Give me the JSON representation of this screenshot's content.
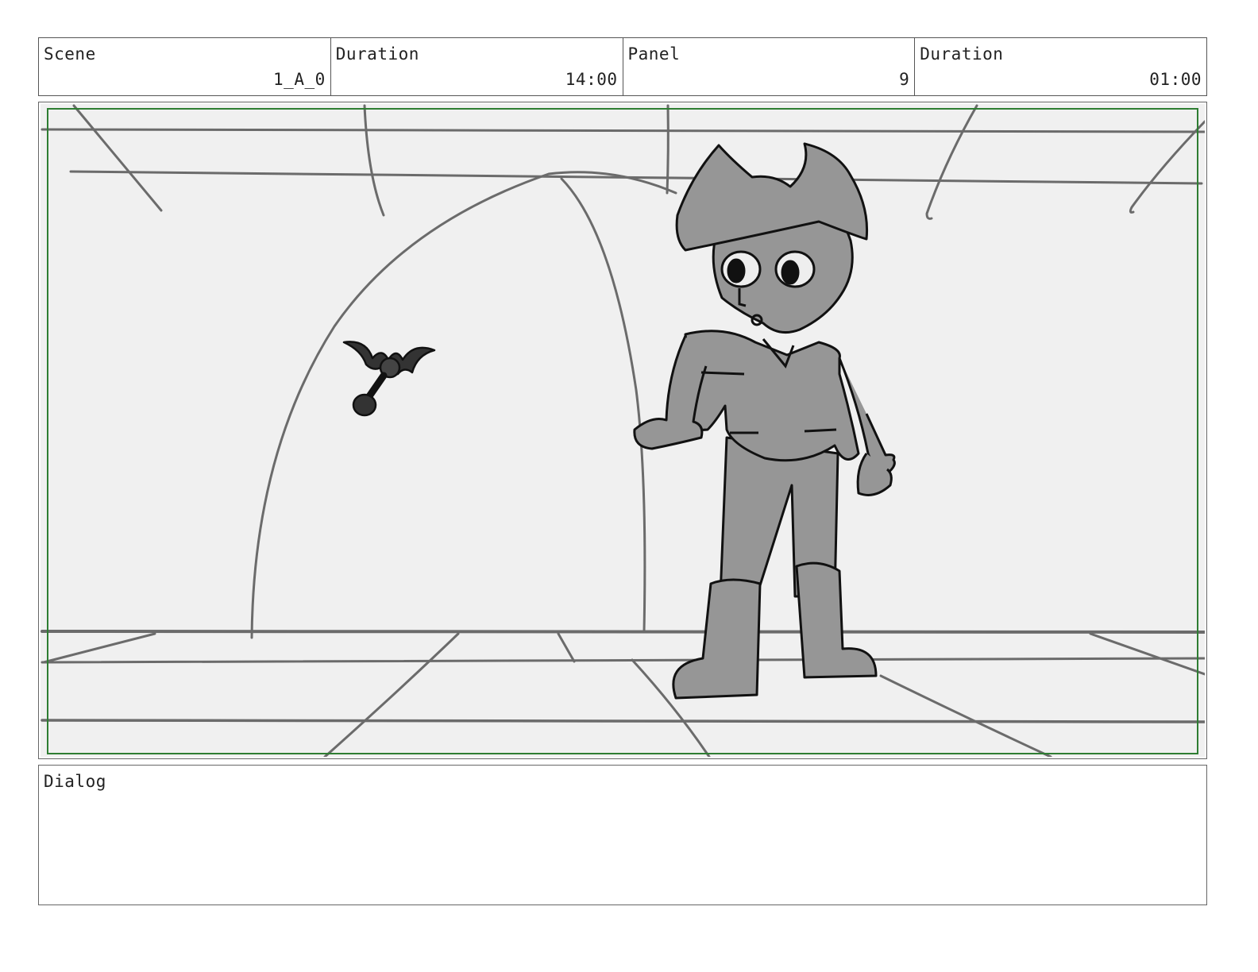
{
  "header": {
    "cells": [
      {
        "label": "Scene",
        "value": "1_A_0"
      },
      {
        "label": "Duration",
        "value": "14:00"
      },
      {
        "label": "Panel",
        "value": "9"
      },
      {
        "label": "Duration",
        "value": "01:00"
      }
    ]
  },
  "dialog": {
    "label": "Dialog",
    "text": ""
  },
  "colors": {
    "panel_bg": "#f0f0f0",
    "safe_frame": "#2e7d32",
    "line": "#6b6b6b",
    "figure_fill": "#969696",
    "bat_fill": "#333333"
  },
  "icons": {
    "character": "character-illustration",
    "bat": "bat-illustration"
  }
}
